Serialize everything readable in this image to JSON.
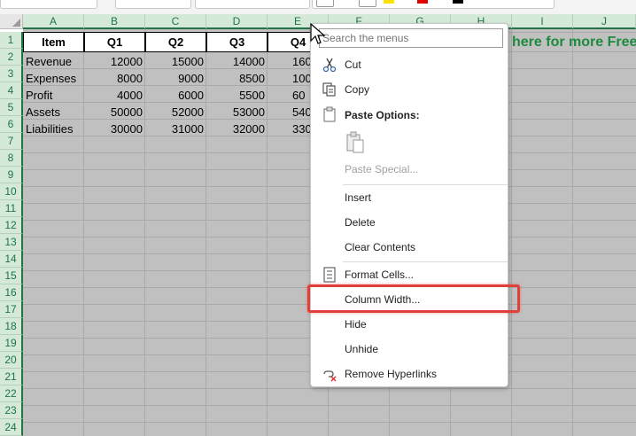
{
  "columns": [
    "A",
    "B",
    "C",
    "D",
    "E",
    "F",
    "G",
    "H",
    "I",
    "J"
  ],
  "rows": [
    "1",
    "2",
    "3",
    "4",
    "5",
    "6",
    "7",
    "8",
    "9",
    "10",
    "11",
    "12",
    "13",
    "14",
    "15",
    "16",
    "17",
    "18",
    "19",
    "20",
    "21",
    "22",
    "23",
    "24"
  ],
  "table": {
    "headers": [
      "Item",
      "Q1",
      "Q2",
      "Q3",
      "Q4"
    ],
    "data": [
      {
        "item": "Revenue",
        "q1": "12000",
        "q2": "15000",
        "q3": "14000",
        "q4": "160"
      },
      {
        "item": "Expenses",
        "q1": "8000",
        "q2": "9000",
        "q3": "8500",
        "q4": "100"
      },
      {
        "item": "Profit",
        "q1": "4000",
        "q2": "6000",
        "q3": "5500",
        "q4": "60"
      },
      {
        "item": "Assets",
        "q1": "50000",
        "q2": "52000",
        "q3": "53000",
        "q4": "540"
      },
      {
        "item": "Liabilities",
        "q1": "30000",
        "q2": "31000",
        "q3": "32000",
        "q4": "330"
      }
    ]
  },
  "banner_text": "here for more Free",
  "context_menu": {
    "search_placeholder": "Search the menus",
    "items": {
      "cut": "Cut",
      "copy": "Copy",
      "paste_options": "Paste Options:",
      "paste_special": "Paste Special...",
      "insert": "Insert",
      "delete": "Delete",
      "clear_contents": "Clear Contents",
      "format_cells": "Format Cells...",
      "column_width": "Column Width...",
      "hide": "Hide",
      "unhide": "Unhide",
      "remove_hyperlinks": "Remove Hyperlinks"
    }
  },
  "colors": {
    "header_green": "#217346",
    "banner_green": "#1e8a3e",
    "highlight_red": "#e0403a",
    "selected_column_bg": "#c0c0c0"
  }
}
